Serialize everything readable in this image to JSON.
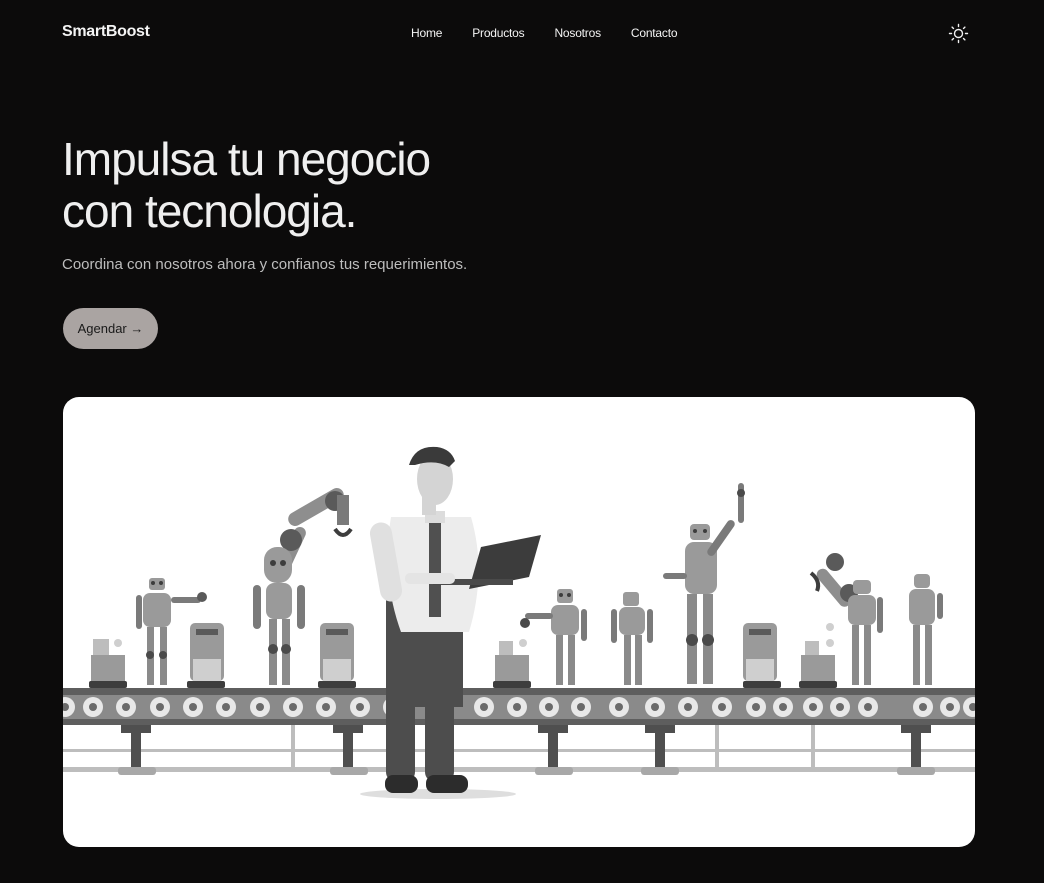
{
  "brand": {
    "name": "SmartBoost"
  },
  "nav": {
    "items": [
      {
        "label": "Home"
      },
      {
        "label": "Productos"
      },
      {
        "label": "Nosotros"
      },
      {
        "label": "Contacto"
      }
    ]
  },
  "theme_toggle": {
    "icon": "sun-icon"
  },
  "hero": {
    "title_line1": "Impulsa tu negocio",
    "title_line2": "con tecnologia.",
    "subtitle": "Coordina con nosotros ahora y confianos tus requerimientos.",
    "cta_label": "Agendar →"
  },
  "illustration": {
    "subject": "man-with-laptop-and-robot-assembly-line",
    "palette": {
      "dark": "#4a4a4a",
      "mid": "#8e8e8e",
      "light": "#c8c8c8",
      "paper": "#ffffff"
    }
  }
}
